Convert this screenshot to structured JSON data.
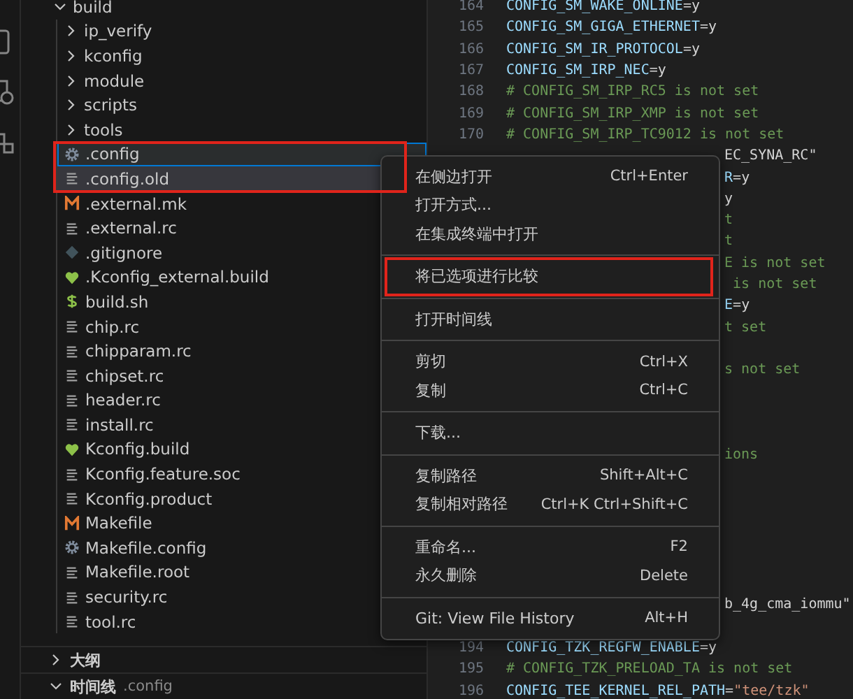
{
  "tree": [
    {
      "label": "build",
      "kind": "folder",
      "expanded": true,
      "selected": false,
      "focused": false,
      "children": [
        {
          "label": "ip_verify",
          "kind": "folder",
          "expanded": false,
          "selected": false,
          "focused": false
        },
        {
          "label": "kconfig",
          "kind": "folder",
          "expanded": false,
          "selected": false,
          "focused": false
        },
        {
          "label": "module",
          "kind": "folder",
          "expanded": false,
          "selected": false,
          "focused": false
        },
        {
          "label": "scripts",
          "kind": "folder",
          "expanded": false,
          "selected": false,
          "focused": false
        },
        {
          "label": "tools",
          "kind": "folder",
          "expanded": false,
          "selected": false,
          "focused": false
        },
        {
          "label": ".config",
          "kind": "gear",
          "selected": true,
          "focused": true,
          "annotated": true
        },
        {
          "label": ".config.old",
          "kind": "lines",
          "selected": true,
          "focused": false,
          "annotated": true
        },
        {
          "label": ".external.mk",
          "kind": "makefile",
          "selected": false,
          "focused": false
        },
        {
          "label": ".external.rc",
          "kind": "lines",
          "selected": false,
          "focused": false
        },
        {
          "label": ".gitignore",
          "kind": "git",
          "selected": false,
          "focused": false
        },
        {
          "label": ".Kconfig_external.build",
          "kind": "heart",
          "selected": false,
          "focused": false
        },
        {
          "label": "build.sh",
          "kind": "shell",
          "selected": false,
          "focused": false
        },
        {
          "label": "chip.rc",
          "kind": "lines",
          "selected": false,
          "focused": false
        },
        {
          "label": "chipparam.rc",
          "kind": "lines",
          "selected": false,
          "focused": false
        },
        {
          "label": "chipset.rc",
          "kind": "lines",
          "selected": false,
          "focused": false
        },
        {
          "label": "header.rc",
          "kind": "lines",
          "selected": false,
          "focused": false
        },
        {
          "label": "install.rc",
          "kind": "lines",
          "selected": false,
          "focused": false
        },
        {
          "label": "Kconfig.build",
          "kind": "heart",
          "selected": false,
          "focused": false
        },
        {
          "label": "Kconfig.feature.soc",
          "kind": "lines",
          "selected": false,
          "focused": false
        },
        {
          "label": "Kconfig.product",
          "kind": "lines",
          "selected": false,
          "focused": false
        },
        {
          "label": "Makefile",
          "kind": "makefile",
          "selected": false,
          "focused": false
        },
        {
          "label": "Makefile.config",
          "kind": "gear",
          "selected": false,
          "focused": false
        },
        {
          "label": "Makefile.root",
          "kind": "lines",
          "selected": false,
          "focused": false
        },
        {
          "label": "security.rc",
          "kind": "lines",
          "selected": false,
          "focused": false
        },
        {
          "label": "tool.rc",
          "kind": "lines",
          "selected": false,
          "focused": false
        }
      ]
    }
  ],
  "panels": [
    {
      "title": "大纲",
      "expanded": false
    },
    {
      "title": "时间线",
      "expanded": true,
      "subtitle": ".config"
    }
  ],
  "code_lines": [
    {
      "number": "164",
      "kind": "setting",
      "text": "CONFIG_SM_WAKE_ONLINE=y"
    },
    {
      "number": "165",
      "kind": "setting",
      "text": "CONFIG_SM_GIGA_ETHERNET=y"
    },
    {
      "number": "166",
      "kind": "setting",
      "text": "CONFIG_SM_IR_PROTOCOL=y"
    },
    {
      "number": "167",
      "kind": "setting",
      "text": "CONFIG_SM_IRP_NEC=y"
    },
    {
      "number": "168",
      "kind": "comment",
      "text": "# CONFIG_SM_IRP_RC5 is not set"
    },
    {
      "number": "169",
      "kind": "comment",
      "text": "# CONFIG_SM_IRP_XMP is not set"
    },
    {
      "number": "170",
      "kind": "comment",
      "text": "# CONFIG_SM_IRP_TC9012 is not set"
    },
    {
      "kind": "setting",
      "text": "EC_SYNA_RC\""
    },
    {
      "kind": "setting",
      "text": "R=y"
    },
    {
      "kind": "setting",
      "text": "y"
    },
    {
      "kind": "comment",
      "text": "t"
    },
    {
      "kind": "comment",
      "text": "t"
    },
    {
      "kind": "comment",
      "text": "E is not set"
    },
    {
      "kind": "comment",
      "text": " is not set"
    },
    {
      "kind": "setting",
      "text": "E=y"
    },
    {
      "kind": "comment",
      "text": "t set"
    },
    {
      "kind": "blank"
    },
    {
      "kind": "comment",
      "text": "s not set"
    },
    {
      "kind": "blank"
    },
    {
      "kind": "blank"
    },
    {
      "kind": "blank"
    },
    {
      "kind": "comment",
      "text": "ions"
    },
    {
      "kind": "blank"
    },
    {
      "kind": "blank"
    },
    {
      "kind": "blank"
    },
    {
      "kind": "blank"
    },
    {
      "kind": "blank"
    },
    {
      "kind": "blank"
    },
    {
      "kind": "setting",
      "text": "b_4g_cma_iommu\""
    },
    {
      "kind": "blank"
    },
    {
      "number": "194",
      "kind": "setting",
      "text": "CONFIG_TZK_REGFW_ENABLE=y"
    },
    {
      "number": "195",
      "kind": "comment",
      "text": "# CONFIG_TZK_PRELOAD_TA is not set"
    },
    {
      "number": "196",
      "kind": "setting",
      "text": "CONFIG_TEE_KERNEL_REL_PATH=\"tee/tzk\""
    }
  ],
  "context_menu": [
    {
      "kind": "item",
      "label": "在侧边打开",
      "shortcut": "Ctrl+Enter"
    },
    {
      "kind": "item",
      "label": "打开方式..."
    },
    {
      "kind": "item",
      "label": "在集成终端中打开"
    },
    {
      "kind": "separator"
    },
    {
      "kind": "item",
      "label": "将已选项进行比较",
      "annotated": true
    },
    {
      "kind": "separator"
    },
    {
      "kind": "item",
      "label": "打开时间线"
    },
    {
      "kind": "separator"
    },
    {
      "kind": "item",
      "label": "剪切",
      "shortcut": "Ctrl+X"
    },
    {
      "kind": "item",
      "label": "复制",
      "shortcut": "Ctrl+C"
    },
    {
      "kind": "separator"
    },
    {
      "kind": "item",
      "label": "下载..."
    },
    {
      "kind": "separator"
    },
    {
      "kind": "item",
      "label": "复制路径",
      "shortcut": "Shift+Alt+C"
    },
    {
      "kind": "item",
      "label": "复制相对路径",
      "shortcut": "Ctrl+K Ctrl+Shift+C"
    },
    {
      "kind": "separator"
    },
    {
      "kind": "item",
      "label": "重命名...",
      "shortcut": "F2"
    },
    {
      "kind": "item",
      "label": "永久删除",
      "shortcut": "Delete"
    },
    {
      "kind": "separator"
    },
    {
      "kind": "item",
      "label": "Git: View File History",
      "shortcut": "Alt+H"
    }
  ]
}
